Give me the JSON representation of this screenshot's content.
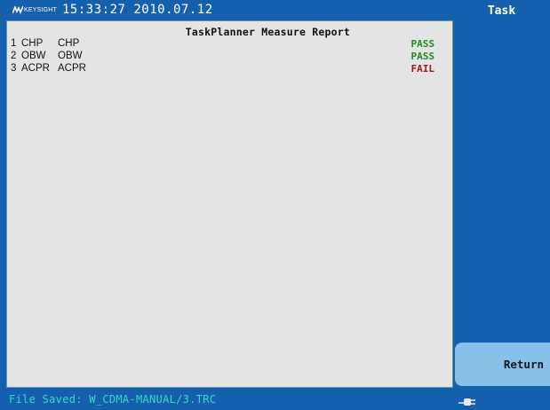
{
  "header": {
    "logo_text": "KEYSIGHT",
    "datetime": "15:33:27 2010.07.12",
    "logo_icon": "keysight-wave-icon"
  },
  "report": {
    "title": "TaskPlanner Measure Report",
    "rows": [
      {
        "index": "1",
        "name": "CHP",
        "description": "CHP",
        "result": "PASS",
        "result_color": "#1f8a1f"
      },
      {
        "index": "2",
        "name": "OBW",
        "description": "OBW",
        "result": "PASS",
        "result_color": "#1f8a1f"
      },
      {
        "index": "3",
        "name": "ACPR",
        "description": "ACPR",
        "result": "FAIL",
        "result_color": "#a31818"
      }
    ]
  },
  "status_bar": {
    "message": "File Saved: W_CDMA-MANUAL/3.TRC"
  },
  "softkeys": {
    "title": "Task",
    "return_label": "Return"
  },
  "icons": {
    "power": "power-plug-icon"
  },
  "colors": {
    "background": "#1560ad",
    "panel": "#e4e4e4",
    "pass": "#1f8a1f",
    "fail": "#a31818",
    "status_text": "#3cd6c4",
    "softkey_button": "#88c0ea"
  }
}
